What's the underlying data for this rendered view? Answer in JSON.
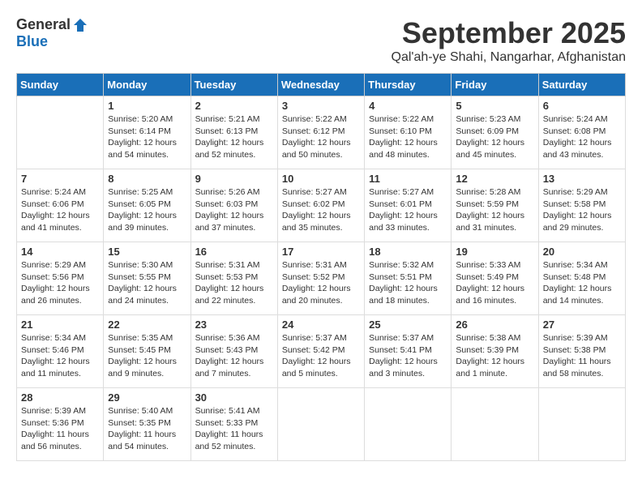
{
  "logo": {
    "general": "General",
    "blue": "Blue"
  },
  "header": {
    "month": "September 2025",
    "location": "Qal'ah-ye Shahi, Nangarhar, Afghanistan"
  },
  "weekdays": [
    "Sunday",
    "Monday",
    "Tuesday",
    "Wednesday",
    "Thursday",
    "Friday",
    "Saturday"
  ],
  "weeks": [
    [
      {
        "day": "",
        "info": ""
      },
      {
        "day": "1",
        "info": "Sunrise: 5:20 AM\nSunset: 6:14 PM\nDaylight: 12 hours\nand 54 minutes."
      },
      {
        "day": "2",
        "info": "Sunrise: 5:21 AM\nSunset: 6:13 PM\nDaylight: 12 hours\nand 52 minutes."
      },
      {
        "day": "3",
        "info": "Sunrise: 5:22 AM\nSunset: 6:12 PM\nDaylight: 12 hours\nand 50 minutes."
      },
      {
        "day": "4",
        "info": "Sunrise: 5:22 AM\nSunset: 6:10 PM\nDaylight: 12 hours\nand 48 minutes."
      },
      {
        "day": "5",
        "info": "Sunrise: 5:23 AM\nSunset: 6:09 PM\nDaylight: 12 hours\nand 45 minutes."
      },
      {
        "day": "6",
        "info": "Sunrise: 5:24 AM\nSunset: 6:08 PM\nDaylight: 12 hours\nand 43 minutes."
      }
    ],
    [
      {
        "day": "7",
        "info": "Sunrise: 5:24 AM\nSunset: 6:06 PM\nDaylight: 12 hours\nand 41 minutes."
      },
      {
        "day": "8",
        "info": "Sunrise: 5:25 AM\nSunset: 6:05 PM\nDaylight: 12 hours\nand 39 minutes."
      },
      {
        "day": "9",
        "info": "Sunrise: 5:26 AM\nSunset: 6:03 PM\nDaylight: 12 hours\nand 37 minutes."
      },
      {
        "day": "10",
        "info": "Sunrise: 5:27 AM\nSunset: 6:02 PM\nDaylight: 12 hours\nand 35 minutes."
      },
      {
        "day": "11",
        "info": "Sunrise: 5:27 AM\nSunset: 6:01 PM\nDaylight: 12 hours\nand 33 minutes."
      },
      {
        "day": "12",
        "info": "Sunrise: 5:28 AM\nSunset: 5:59 PM\nDaylight: 12 hours\nand 31 minutes."
      },
      {
        "day": "13",
        "info": "Sunrise: 5:29 AM\nSunset: 5:58 PM\nDaylight: 12 hours\nand 29 minutes."
      }
    ],
    [
      {
        "day": "14",
        "info": "Sunrise: 5:29 AM\nSunset: 5:56 PM\nDaylight: 12 hours\nand 26 minutes."
      },
      {
        "day": "15",
        "info": "Sunrise: 5:30 AM\nSunset: 5:55 PM\nDaylight: 12 hours\nand 24 minutes."
      },
      {
        "day": "16",
        "info": "Sunrise: 5:31 AM\nSunset: 5:53 PM\nDaylight: 12 hours\nand 22 minutes."
      },
      {
        "day": "17",
        "info": "Sunrise: 5:31 AM\nSunset: 5:52 PM\nDaylight: 12 hours\nand 20 minutes."
      },
      {
        "day": "18",
        "info": "Sunrise: 5:32 AM\nSunset: 5:51 PM\nDaylight: 12 hours\nand 18 minutes."
      },
      {
        "day": "19",
        "info": "Sunrise: 5:33 AM\nSunset: 5:49 PM\nDaylight: 12 hours\nand 16 minutes."
      },
      {
        "day": "20",
        "info": "Sunrise: 5:34 AM\nSunset: 5:48 PM\nDaylight: 12 hours\nand 14 minutes."
      }
    ],
    [
      {
        "day": "21",
        "info": "Sunrise: 5:34 AM\nSunset: 5:46 PM\nDaylight: 12 hours\nand 11 minutes."
      },
      {
        "day": "22",
        "info": "Sunrise: 5:35 AM\nSunset: 5:45 PM\nDaylight: 12 hours\nand 9 minutes."
      },
      {
        "day": "23",
        "info": "Sunrise: 5:36 AM\nSunset: 5:43 PM\nDaylight: 12 hours\nand 7 minutes."
      },
      {
        "day": "24",
        "info": "Sunrise: 5:37 AM\nSunset: 5:42 PM\nDaylight: 12 hours\nand 5 minutes."
      },
      {
        "day": "25",
        "info": "Sunrise: 5:37 AM\nSunset: 5:41 PM\nDaylight: 12 hours\nand 3 minutes."
      },
      {
        "day": "26",
        "info": "Sunrise: 5:38 AM\nSunset: 5:39 PM\nDaylight: 12 hours\nand 1 minute."
      },
      {
        "day": "27",
        "info": "Sunrise: 5:39 AM\nSunset: 5:38 PM\nDaylight: 11 hours\nand 58 minutes."
      }
    ],
    [
      {
        "day": "28",
        "info": "Sunrise: 5:39 AM\nSunset: 5:36 PM\nDaylight: 11 hours\nand 56 minutes."
      },
      {
        "day": "29",
        "info": "Sunrise: 5:40 AM\nSunset: 5:35 PM\nDaylight: 11 hours\nand 54 minutes."
      },
      {
        "day": "30",
        "info": "Sunrise: 5:41 AM\nSunset: 5:33 PM\nDaylight: 11 hours\nand 52 minutes."
      },
      {
        "day": "",
        "info": ""
      },
      {
        "day": "",
        "info": ""
      },
      {
        "day": "",
        "info": ""
      },
      {
        "day": "",
        "info": ""
      }
    ]
  ]
}
